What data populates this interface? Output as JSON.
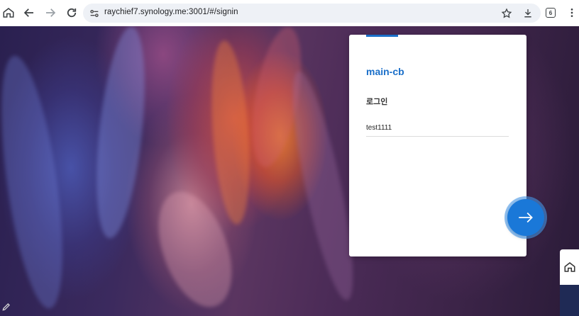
{
  "browser": {
    "url": "raychief7.synology.me:3001/#/signin",
    "tab_count": "6",
    "icons": {
      "home": "home-icon",
      "back": "arrow-left-icon",
      "forward": "arrow-right-icon",
      "reload": "reload-icon",
      "site_info": "tune-icon",
      "bookmark": "star-icon",
      "download": "download-icon",
      "menu": "more-vertical-icon"
    }
  },
  "login": {
    "app_name": "main-cb",
    "title": "로그인",
    "username_value": "test1111",
    "next_icon": "arrow-right-icon",
    "accent_color": "#1a6fc9"
  },
  "floating": {
    "home_icon": "home-icon",
    "edit_icon": "pen-icon"
  }
}
